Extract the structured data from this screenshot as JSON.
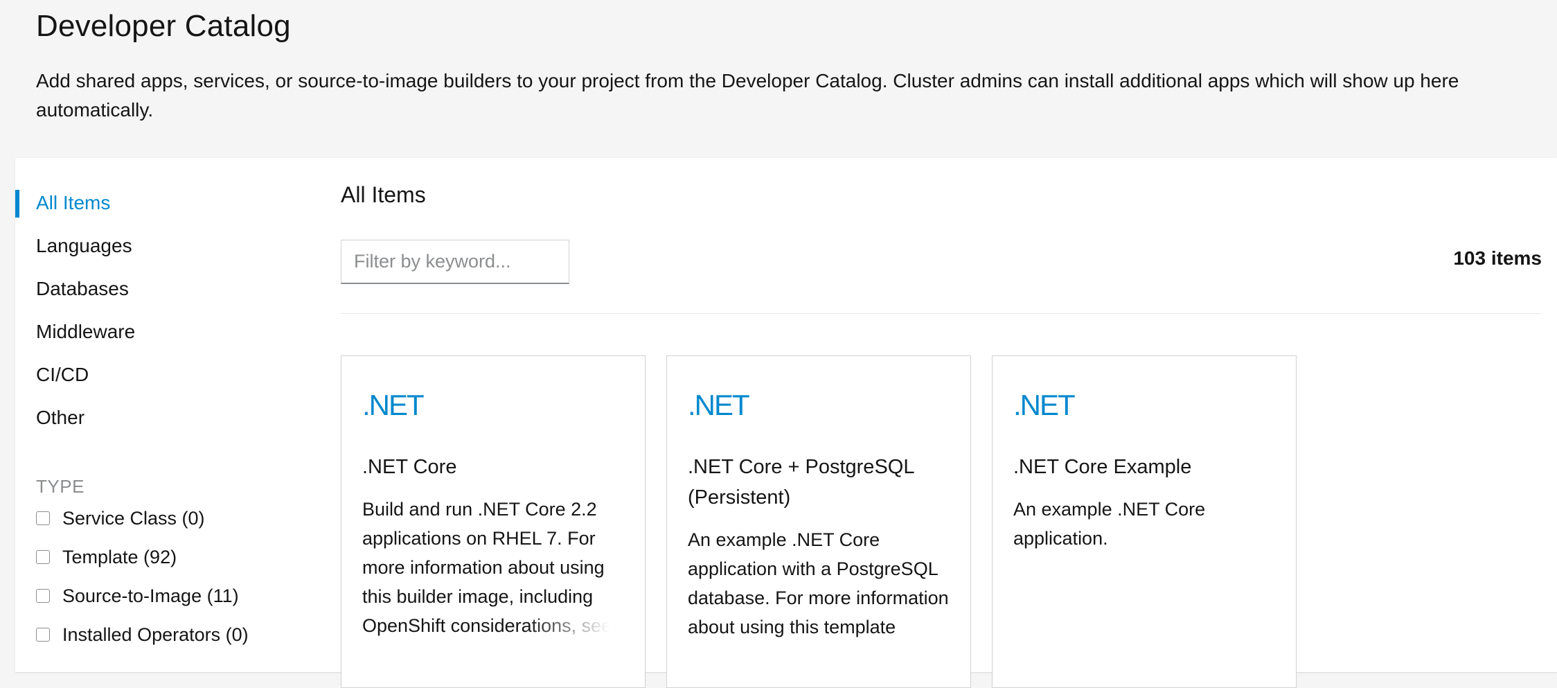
{
  "header": {
    "title": "Developer Catalog",
    "description": "Add shared apps, services, or source-to-image builders to your project from the Developer Catalog. Cluster admins can install additional apps which will show up here automatically."
  },
  "sidebar": {
    "categories": [
      {
        "label": "All Items",
        "active": true
      },
      {
        "label": "Languages",
        "active": false
      },
      {
        "label": "Databases",
        "active": false
      },
      {
        "label": "Middleware",
        "active": false
      },
      {
        "label": "CI/CD",
        "active": false
      },
      {
        "label": "Other",
        "active": false
      }
    ],
    "type_heading": "TYPE",
    "types": [
      {
        "label": "Service Class (0)",
        "checked": false
      },
      {
        "label": "Template (92)",
        "checked": false
      },
      {
        "label": "Source-to-Image (11)",
        "checked": false
      },
      {
        "label": "Installed Operators (0)",
        "checked": false
      }
    ]
  },
  "content": {
    "title": "All Items",
    "filter_placeholder": "Filter by keyword...",
    "item_count": "103 items",
    "tiles": [
      {
        "logo_text": ".NET",
        "title": ".NET Core",
        "description": "Build and run .NET Core 2.2 applications on RHEL 7. For more information about using this builder image, including OpenShift considerations, see"
      },
      {
        "logo_text": ".NET",
        "title": ".NET Core + PostgreSQL (Persistent)",
        "description": "An example .NET Core application with a PostgreSQL database. For more information about using this template"
      },
      {
        "logo_text": ".NET",
        "title": ".NET Core Example",
        "description": "An example .NET Core application."
      }
    ]
  },
  "colors": {
    "accent": "#0088ce",
    "page_background": "#f5f5f5",
    "text": "#151515",
    "muted": "#8b8d8f"
  }
}
